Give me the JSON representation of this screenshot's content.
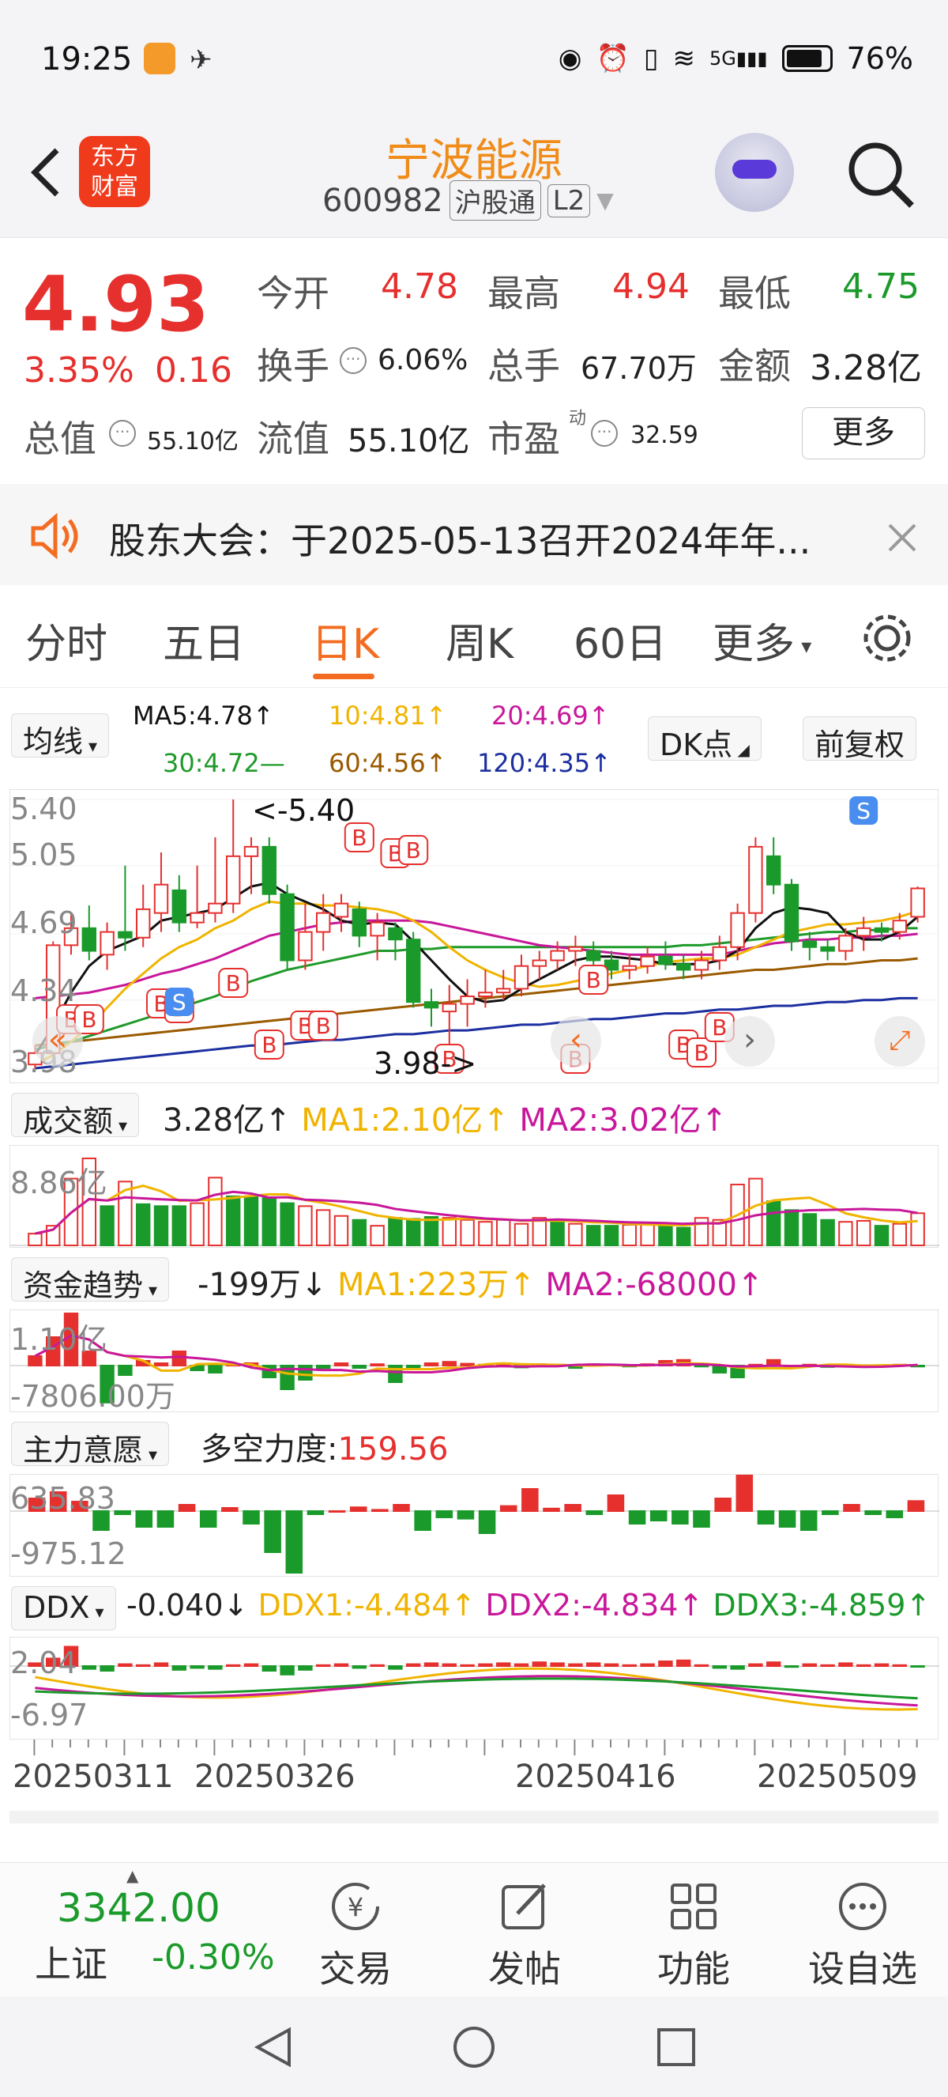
{
  "status_bar": {
    "time": "19:25",
    "battery": "76%",
    "network": "5G"
  },
  "header": {
    "title": "宁波能源",
    "code": "600982",
    "badge1": "沪股通",
    "badge2": "L2",
    "logo_line1": "东方",
    "logo_line2": "财富"
  },
  "quote": {
    "price": "4.93",
    "change_pct": "3.35%",
    "change": "0.16",
    "open_label": "今开",
    "open": "4.78",
    "high_label": "最高",
    "high": "4.94",
    "low_label": "最低",
    "low": "4.75",
    "turnover_label": "换手",
    "turnover": "6.06%",
    "volume_label": "总手",
    "volume": "67.70万",
    "amount_label": "金额",
    "amount": "3.28亿",
    "mcap_label": "总值",
    "mcap": "55.10亿",
    "float_label": "流值",
    "float": "55.10亿",
    "pe_label": "市盈",
    "pe_sup": "动",
    "pe": "32.59",
    "more_button": "更多"
  },
  "notice": {
    "text": "股东大会：于2025-05-13召开2024年年..."
  },
  "tabs": [
    "分时",
    "五日",
    "日K",
    "周K",
    "60日",
    "更多"
  ],
  "tabs_active": 2,
  "chart_header": {
    "ma_select": "均线",
    "ma5": "MA5:4.78↑",
    "ma10": "10:4.81↑",
    "ma20": "20:4.69↑",
    "ma30": "30:4.72—",
    "ma60": "60:4.56↑",
    "ma120": "120:4.35↑",
    "dk_button": "DK点",
    "adjust_button": "前复权"
  },
  "colors": {
    "up": "#e5302e",
    "down": "#1a9a2a",
    "ma5": "#111111",
    "ma10": "#f0b400",
    "ma20": "#c8179a",
    "ma30": "#1f9a2a",
    "ma60": "#9a5a00",
    "ma120": "#1c2fa0",
    "accent": "#f36c21"
  },
  "chart_data": {
    "type": "candlestick",
    "y_ticks": [
      "5.40",
      "5.05",
      "4.69",
      "4.34",
      "3.98"
    ],
    "max_label": "<-5.40",
    "min_label": "3.98->",
    "x_labels": [
      "20250311",
      "20250326",
      "20250416",
      "20250509"
    ],
    "candles": [
      [
        4.0,
        4.06,
        3.98,
        4.1
      ],
      [
        4.06,
        4.63,
        4.05,
        4.65
      ],
      [
        4.63,
        4.72,
        4.58,
        4.8
      ],
      [
        4.72,
        4.6,
        4.55,
        4.84
      ],
      [
        4.58,
        4.7,
        4.5,
        4.75
      ],
      [
        4.7,
        4.67,
        4.6,
        5.05
      ],
      [
        4.67,
        4.82,
        4.62,
        4.95
      ],
      [
        4.8,
        4.95,
        4.7,
        5.12
      ],
      [
        4.92,
        4.75,
        4.7,
        5.0
      ],
      [
        4.75,
        4.8,
        4.72,
        5.05
      ],
      [
        4.8,
        4.85,
        4.75,
        5.2
      ],
      [
        4.85,
        5.1,
        4.8,
        5.4
      ],
      [
        5.1,
        5.15,
        4.9,
        5.2
      ],
      [
        5.15,
        4.9,
        4.85,
        5.2
      ],
      [
        4.9,
        4.55,
        4.5,
        4.95
      ],
      [
        4.55,
        4.7,
        4.5,
        4.85
      ],
      [
        4.7,
        4.8,
        4.6,
        4.9
      ],
      [
        4.78,
        4.85,
        4.7,
        4.9
      ],
      [
        4.82,
        4.68,
        4.62,
        4.86
      ],
      [
        4.68,
        4.75,
        4.55,
        4.8
      ],
      [
        4.72,
        4.66,
        4.55,
        4.75
      ],
      [
        4.66,
        4.33,
        4.3,
        4.7
      ],
      [
        4.33,
        4.3,
        4.2,
        4.4
      ],
      [
        4.28,
        4.32,
        3.98,
        4.42
      ],
      [
        4.32,
        4.36,
        4.2,
        4.45
      ],
      [
        4.36,
        4.38,
        4.3,
        4.5
      ],
      [
        4.38,
        4.4,
        4.34,
        4.5
      ],
      [
        4.4,
        4.52,
        4.36,
        4.58
      ],
      [
        4.52,
        4.55,
        4.45,
        4.6
      ],
      [
        4.55,
        4.6,
        4.5,
        4.65
      ],
      [
        4.6,
        4.62,
        4.52,
        4.68
      ],
      [
        4.6,
        4.55,
        4.5,
        4.65
      ],
      [
        4.55,
        4.5,
        4.45,
        4.6
      ],
      [
        4.5,
        4.52,
        4.45,
        4.58
      ],
      [
        4.52,
        4.57,
        4.48,
        4.62
      ],
      [
        4.57,
        4.53,
        4.5,
        4.65
      ],
      [
        4.53,
        4.5,
        4.45,
        4.58
      ],
      [
        4.5,
        4.55,
        4.45,
        4.6
      ],
      [
        4.55,
        4.62,
        4.5,
        4.68
      ],
      [
        4.62,
        4.8,
        4.55,
        4.85
      ],
      [
        4.8,
        5.15,
        4.75,
        5.2
      ],
      [
        5.1,
        4.95,
        4.9,
        5.2
      ],
      [
        4.95,
        4.65,
        4.6,
        4.98
      ],
      [
        4.65,
        4.62,
        4.55,
        4.7
      ],
      [
        4.62,
        4.6,
        4.55,
        4.66
      ],
      [
        4.6,
        4.68,
        4.55,
        4.72
      ],
      [
        4.68,
        4.72,
        4.6,
        4.78
      ],
      [
        4.72,
        4.7,
        4.65,
        4.75
      ],
      [
        4.7,
        4.76,
        4.66,
        4.8
      ],
      [
        4.78,
        4.93,
        4.75,
        4.94
      ]
    ],
    "ma5": [
      4.05,
      4.2,
      4.38,
      4.52,
      4.6,
      4.64,
      4.68,
      4.76,
      4.78,
      4.8,
      4.82,
      4.88,
      4.94,
      4.96,
      4.9,
      4.86,
      4.82,
      4.76,
      4.74,
      4.75,
      4.74,
      4.65,
      4.55,
      4.45,
      4.36,
      4.33,
      4.34,
      4.4,
      4.45,
      4.5,
      4.55,
      4.57,
      4.57,
      4.56,
      4.55,
      4.53,
      4.53,
      4.53,
      4.55,
      4.6,
      4.72,
      4.8,
      4.83,
      4.82,
      4.8,
      4.7,
      4.66,
      4.66,
      4.7,
      4.78
    ],
    "ma10": [
      4.0,
      4.05,
      4.12,
      4.2,
      4.3,
      4.4,
      4.48,
      4.56,
      4.62,
      4.66,
      4.72,
      4.76,
      4.82,
      4.86,
      4.85,
      4.85,
      4.84,
      4.84,
      4.83,
      4.82,
      4.8,
      4.76,
      4.7,
      4.62,
      4.55,
      4.5,
      4.46,
      4.43,
      4.41,
      4.42,
      4.44,
      4.46,
      4.48,
      4.5,
      4.52,
      4.54,
      4.55,
      4.56,
      4.56,
      4.58,
      4.62,
      4.66,
      4.7,
      4.72,
      4.74,
      4.74,
      4.75,
      4.76,
      4.78,
      4.81
    ],
    "ma20": [
      4.35,
      4.36,
      4.37,
      4.38,
      4.4,
      4.42,
      4.45,
      4.48,
      4.5,
      4.53,
      4.56,
      4.6,
      4.64,
      4.68,
      4.7,
      4.72,
      4.74,
      4.75,
      4.76,
      4.76,
      4.76,
      4.76,
      4.75,
      4.73,
      4.71,
      4.69,
      4.67,
      4.65,
      4.63,
      4.62,
      4.61,
      4.6,
      4.59,
      4.58,
      4.58,
      4.58,
      4.58,
      4.58,
      4.58,
      4.6,
      4.62,
      4.64,
      4.65,
      4.66,
      4.66,
      4.67,
      4.67,
      4.68,
      4.68,
      4.69
    ],
    "ma30": [
      4.08,
      4.1,
      4.12,
      4.15,
      4.18,
      4.21,
      4.24,
      4.27,
      4.3,
      4.33,
      4.36,
      4.4,
      4.44,
      4.47,
      4.5,
      4.52,
      4.54,
      4.56,
      4.58,
      4.6,
      4.6,
      4.61,
      4.61,
      4.62,
      4.62,
      4.62,
      4.62,
      4.62,
      4.62,
      4.62,
      4.62,
      4.62,
      4.62,
      4.62,
      4.62,
      4.62,
      4.63,
      4.63,
      4.64,
      4.65,
      4.66,
      4.67,
      4.68,
      4.69,
      4.7,
      4.7,
      4.71,
      4.71,
      4.72,
      4.72
    ],
    "ma60": [
      4.1,
      4.11,
      4.12,
      4.13,
      4.14,
      4.15,
      4.16,
      4.17,
      4.18,
      4.19,
      4.2,
      4.21,
      4.22,
      4.23,
      4.24,
      4.25,
      4.26,
      4.27,
      4.28,
      4.29,
      4.3,
      4.31,
      4.32,
      4.33,
      4.34,
      4.35,
      4.36,
      4.37,
      4.38,
      4.39,
      4.4,
      4.41,
      4.42,
      4.43,
      4.44,
      4.45,
      4.46,
      4.47,
      4.48,
      4.49,
      4.5,
      4.5,
      4.51,
      4.52,
      4.53,
      4.53,
      4.54,
      4.55,
      4.55,
      4.56
    ],
    "ma120": [
      3.98,
      3.99,
      4.0,
      4.01,
      4.02,
      4.03,
      4.04,
      4.05,
      4.06,
      4.07,
      4.08,
      4.09,
      4.1,
      4.1,
      4.11,
      4.12,
      4.13,
      4.13,
      4.14,
      4.15,
      4.16,
      4.16,
      4.17,
      4.18,
      4.18,
      4.19,
      4.2,
      4.21,
      4.21,
      4.22,
      4.23,
      4.24,
      4.24,
      4.25,
      4.26,
      4.27,
      4.27,
      4.28,
      4.29,
      4.29,
      4.3,
      4.31,
      4.31,
      4.32,
      4.33,
      4.33,
      4.34,
      4.34,
      4.35,
      4.35
    ],
    "markers_b_label": "B",
    "markers_s_label": "S"
  },
  "volume_panel": {
    "select": "成交额",
    "value": "3.28亿↑",
    "ma1": "MA1:2.10亿↑",
    "ma2": "MA2:3.02亿↑",
    "y_max": "8.86亿",
    "values": [
      1.2,
      2.0,
      6.8,
      8.86,
      4.0,
      6.5,
      4.2,
      4.0,
      4.0,
      4.3,
      6.9,
      5.0,
      5.0,
      4.8,
      4.3,
      4.0,
      3.6,
      3.0,
      2.6,
      2.0,
      2.8,
      2.7,
      2.9,
      2.8,
      2.6,
      2.4,
      2.6,
      2.2,
      2.8,
      2.6,
      2.2,
      2.0,
      2.0,
      2.1,
      2.3,
      2.0,
      1.8,
      2.8,
      2.6,
      6.2,
      6.8,
      4.5,
      3.6,
      3.2,
      2.6,
      2.4,
      2.5,
      2.0,
      2.2,
      3.28
    ],
    "up": [
      1,
      1,
      1,
      1,
      0,
      1,
      0,
      0,
      0,
      1,
      1,
      0,
      0,
      0,
      0,
      1,
      1,
      1,
      0,
      1,
      0,
      0,
      0,
      1,
      1,
      1,
      1,
      1,
      1,
      0,
      1,
      0,
      0,
      1,
      1,
      0,
      0,
      1,
      1,
      1,
      1,
      0,
      0,
      0,
      0,
      1,
      1,
      0,
      1,
      1
    ]
  },
  "fund_panel": {
    "select": "资金趋势",
    "value": "-199万↓",
    "ma1": "MA1:223万↑",
    "ma2": "MA2:-68000↑",
    "y_top": "1.10亿",
    "y_bottom": "-7806.00万",
    "values": [
      0.2,
      0.6,
      1.1,
      0.3,
      -0.78,
      -0.2,
      0.1,
      0.05,
      0.3,
      -0.1,
      -0.15,
      0.02,
      0.05,
      -0.25,
      -0.5,
      -0.3,
      -0.05,
      0.05,
      -0.05,
      0.03,
      -0.35,
      -0.05,
      0.05,
      0.08,
      0.04,
      0.02,
      0.05,
      -0.04,
      0.03,
      0.02,
      -0.05,
      0.03,
      0.02,
      -0.02,
      0.03,
      0.1,
      0.12,
      -0.02,
      -0.15,
      -0.25,
      0.02,
      0.12,
      -0.03,
      0.02,
      -0.03,
      0.02,
      0.01,
      0.01,
      0.02,
      -0.02
    ]
  },
  "force_panel": {
    "select": "主力意愿",
    "label": "多空力度:",
    "value": "159.56",
    "y_top": "635.83",
    "y_bottom": "-975.12",
    "values": [
      200,
      300,
      150,
      -300,
      -50,
      -250,
      -250,
      100,
      -250,
      50,
      -200,
      -650,
      -975,
      -50,
      0,
      60,
      20,
      100,
      -300,
      -100,
      -120,
      -350,
      80,
      350,
      40,
      100,
      -50,
      250,
      -200,
      -150,
      -200,
      -250,
      200,
      635,
      -200,
      -250,
      -300,
      -50,
      100,
      -50,
      -100,
      159
    ]
  },
  "ddx_panel": {
    "select": "DDX",
    "value": "-0.040↓",
    "ddx1": "DDX1:-4.484↑",
    "ddx2": "DDX2:-4.834↑",
    "ddx3": "DDX3:-4.859↑",
    "y_top": "2.04",
    "y_bottom": "-6.97",
    "values": [
      0.3,
      0.8,
      2.04,
      -0.3,
      -0.5,
      0.2,
      0.1,
      0.3,
      -0.4,
      -0.2,
      -0.3,
      0.1,
      0.2,
      -0.5,
      -0.9,
      -0.4,
      0.1,
      0.2,
      -0.2,
      0.1,
      -0.3,
      0.2,
      0.3,
      0.2,
      0.1,
      0.2,
      0.3,
      0.2,
      0.4,
      0.3,
      0.2,
      0.3,
      0.2,
      0.1,
      0.2,
      0.5,
      0.6,
      0.1,
      -0.2,
      -0.3,
      0.2,
      0.4,
      -0.1,
      0.2,
      0.1,
      0.3,
      0.1,
      0.2,
      0.1,
      -0.04
    ]
  },
  "bottom_nav": {
    "index_value": "3342.00",
    "index_name": "上证",
    "index_change": "-0.30%",
    "items": [
      "交易",
      "发帖",
      "功能",
      "设自选"
    ]
  }
}
